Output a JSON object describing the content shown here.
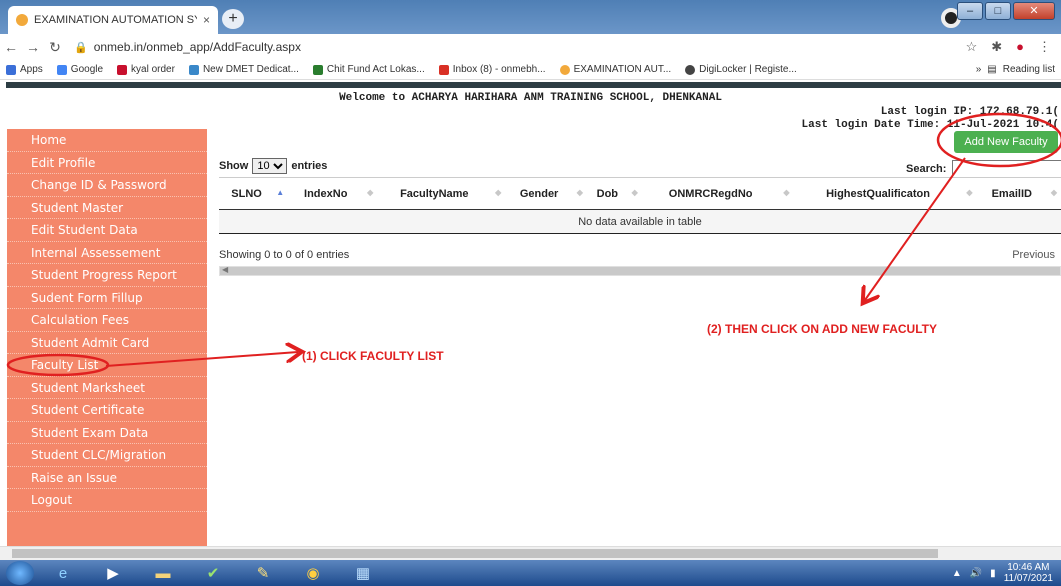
{
  "browser": {
    "tab_title": "EXAMINATION AUTOMATION SY",
    "tab_close": "×",
    "new_tab": "+",
    "url": "onmeb.in/onmeb_app/AddFaculty.aspx",
    "bookmarks": [
      {
        "label": "Apps",
        "color": "#3b6fd8"
      },
      {
        "label": "Google",
        "color": "#4285f4"
      },
      {
        "label": "kyal order",
        "color": "#c8102e"
      },
      {
        "label": "New DMET Dedicat...",
        "color": "#3a88c9"
      },
      {
        "label": "Chit Fund Act Lokas...",
        "color": "#2a7d2e"
      },
      {
        "label": "Inbox (8) - onmebh...",
        "color": "#d93025"
      },
      {
        "label": "EXAMINATION AUT...",
        "color": "#f2a93b"
      },
      {
        "label": "DigiLocker | Registe...",
        "color": "#444444"
      }
    ],
    "more_bookmarks": "»",
    "reading_list": "Reading list"
  },
  "page": {
    "welcome": "Welcome to  ACHARYA HARIHARA ANM TRAINING SCHOOL, DHENKANAL",
    "last_login_ip": "Last login IP: 172.68.79.1(",
    "last_login_time": "Last login Date Time: 11-Jul-2021 10:4(",
    "add_button": "Add New Faculty"
  },
  "sidebar": {
    "items": [
      {
        "label": "Home"
      },
      {
        "label": "Edit Profile"
      },
      {
        "label": "Change ID & Password"
      },
      {
        "label": "Student Master"
      },
      {
        "label": "Edit Student Data"
      },
      {
        "label": "Internal Assessement"
      },
      {
        "label": "Student Progress Report"
      },
      {
        "label": "Sudent Form Fillup"
      },
      {
        "label": "Calculation Fees"
      },
      {
        "label": "Student Admit Card"
      },
      {
        "label": "Faculty List"
      },
      {
        "label": "Student Marksheet"
      },
      {
        "label": "Student Certificate"
      },
      {
        "label": "Student Exam Data"
      },
      {
        "label": "Student CLC/Migration"
      },
      {
        "label": "Raise an Issue"
      },
      {
        "label": "Logout"
      }
    ]
  },
  "table": {
    "show_label": "Show",
    "show_value": "10",
    "entries_label": "entries",
    "search_label": "Search:",
    "columns": [
      "SLNO",
      "IndexNo",
      "FacultyName",
      "Gender",
      "Dob",
      "ONMRCRegdNo",
      "HighestQualificaton",
      "EmailID"
    ],
    "empty_message": "No data available in table",
    "info": "Showing 0 to 0 of 0 entries",
    "previous": "Previous"
  },
  "annotations": {
    "step1": "(1) CLICK FACULTY LIST",
    "step2": "(2) THEN CLICK ON ADD NEW FACULTY",
    "color": "#e02020"
  },
  "taskbar": {
    "time": "10:46 AM",
    "date": "11/07/2021"
  }
}
